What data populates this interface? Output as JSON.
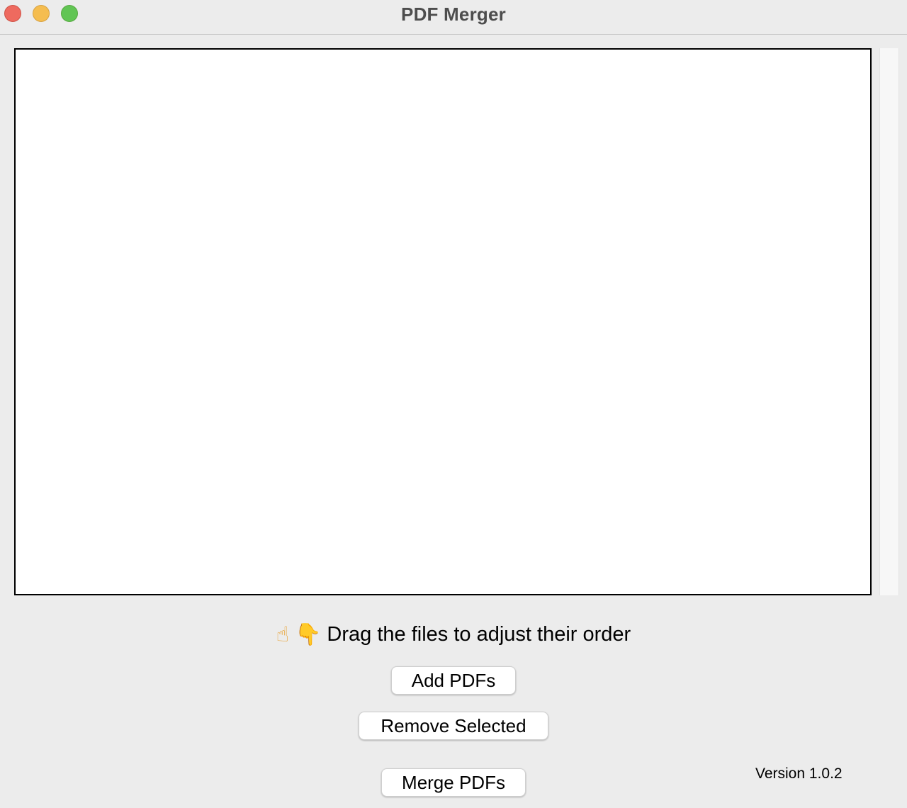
{
  "window": {
    "title": "PDF Merger",
    "traffic_lights": {
      "close_color": "#ee6a5f",
      "minimize_color": "#f5bd4f",
      "maximize_color": "#61c554"
    }
  },
  "file_list": {
    "items": []
  },
  "hint": {
    "icons": [
      "pointing-up-hand-icon",
      "pointing-down-hand-icon"
    ],
    "icon_glyphs": [
      "☝",
      "👇"
    ],
    "text": "Drag the files to adjust their order"
  },
  "buttons": {
    "add_label": "Add PDFs",
    "remove_label": "Remove Selected",
    "merge_label": "Merge PDFs"
  },
  "footer": {
    "version": "Version 1.0.2"
  }
}
